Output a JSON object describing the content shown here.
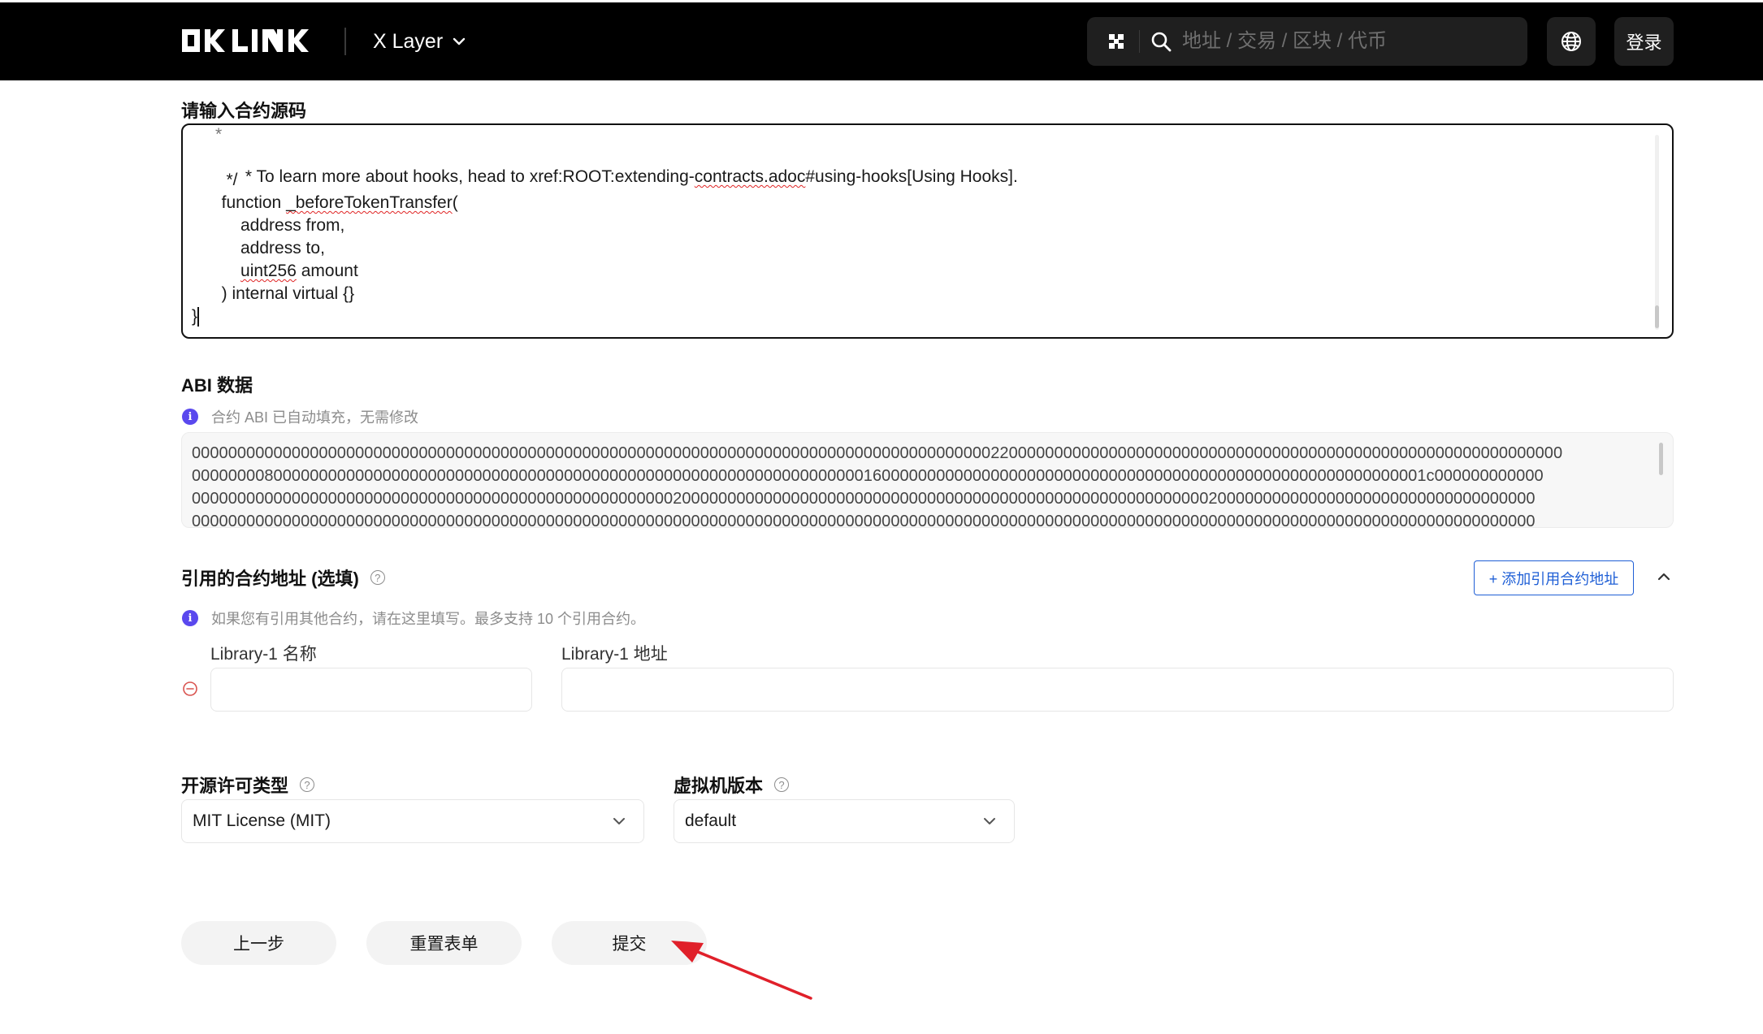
{
  "header": {
    "network": "X Layer",
    "search_placeholder": "地址 / 交易 / 区块 / 代币",
    "login": "登录"
  },
  "source": {
    "label": "请输入合约源码",
    "lines": [
      "   * To learn more about hooks, head to xref:ROOT:extending-contracts.adoc#using-hooks[Using Hooks].",
      "   */",
      "  function _beforeTokenTransfer(",
      "      address from,",
      "      address to,",
      "      uint256 amount",
      "  ) internal virtual {}",
      "}"
    ]
  },
  "abi": {
    "label": "ABI 数据",
    "info": "合约 ABI 已自动填充，无需修改",
    "lines": [
      "0000000000000000000000000000000000000000000000000000000000000000000000000000000000000000220000000000000000000000000000000000000000000000000000000000000",
      "0000000080000000000000000000000000000000000000000000000000000000000000000016000000000000000000000000000000000000000000000000000000000001c000000000000",
      "0000000000000000000000000000000000000000000000000000020000000000000000000000000000000000000000000000000000000000200000000000000000000000000000000000",
      "0000000000000000000000000000000000000000000000000000000000000000000000000000000000000000000000000000000000000000000000000000000000000000000000000000"
    ]
  },
  "library": {
    "label": "引用的合约地址 (选填)",
    "info": "如果您有引用其他合约，请在这里填写。最多支持 10 个引用合约。",
    "add_button": "+ 添加引用合约地址",
    "name_label": "Library-1 名称",
    "address_label": "Library-1 地址",
    "name_value": "",
    "address_value": ""
  },
  "license": {
    "label": "开源许可类型",
    "value": "MIT License (MIT)"
  },
  "evm": {
    "label": "虚拟机版本",
    "value": "default"
  },
  "buttons": {
    "prev": "上一步",
    "reset": "重置表单",
    "submit": "提交"
  },
  "colors": {
    "header_bg": "#000000",
    "accent_blue": "#1f5fd6",
    "info_purple": "#5a48ee",
    "remove_red": "#d9534f",
    "annotation_arrow": "#e0202a"
  }
}
